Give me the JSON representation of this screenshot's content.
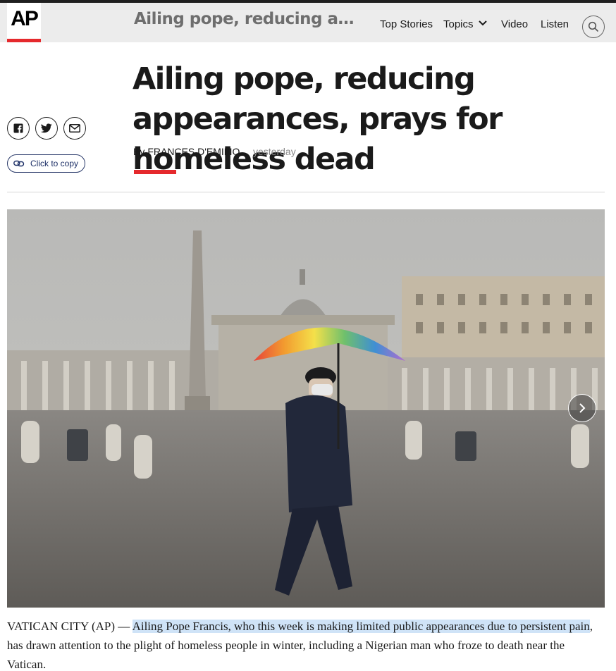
{
  "header": {
    "logo_text": "AP",
    "title": "Ailing pope, reducing appearances, prays for homeless dead",
    "nav": {
      "top_stories": "Top Stories",
      "topics": "Topics",
      "video": "Video",
      "listen": "Listen"
    },
    "icons": {
      "search": "search-icon",
      "topics_chevron": "chevron-down-icon"
    }
  },
  "share": {
    "icons": [
      "facebook-icon",
      "twitter-icon",
      "email-icon"
    ],
    "copy_label": "Click to copy"
  },
  "article": {
    "headline": "Ailing pope, reducing appearances, prays for homeless dead",
    "byline_prefix": "By",
    "author": "FRANCES D'EMILIO",
    "timestamp": "yesterday",
    "body": {
      "dateline": "VATICAN CITY (AP) — ",
      "highlighted": "Ailing Pope Francis, who this week is making limited public appearances due to persistent pain",
      "rest": ", has drawn attention to the plight of homeless people in winter, including a Nigerian man who froze to death near the Vatican."
    }
  },
  "photo": {
    "next_icon": "chevron-right-icon"
  },
  "colors": {
    "accent_red": "#e5292d",
    "header_bg": "#ececec",
    "highlight": "#cfe3f7",
    "link_blue": "#1c2f66"
  }
}
